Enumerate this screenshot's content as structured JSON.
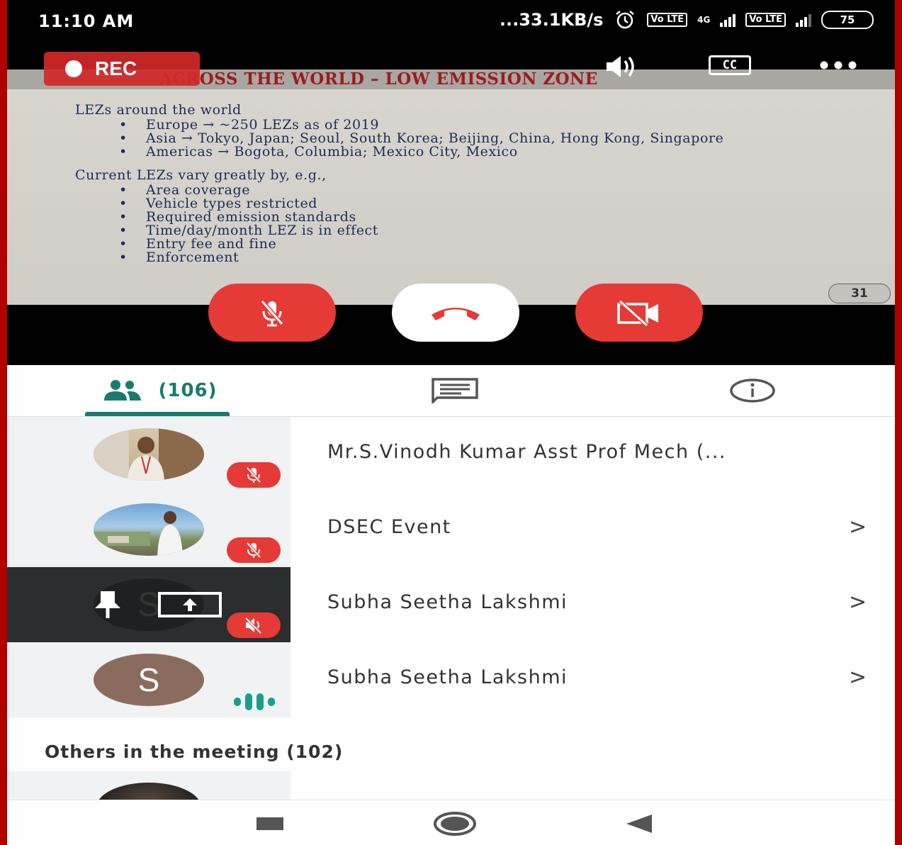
{
  "status_bar": {
    "time": "11:10 AM",
    "network_speed": "...33.1KB/s",
    "battery": "75",
    "volte_1": "Vo LTE",
    "volte_2": "Vo LTE",
    "net_type": "4G"
  },
  "video": {
    "rec_label": "REC",
    "slide": {
      "title": "ACROSS THE WORLD – LOW EMISSION ZONE",
      "section1_heading": "LEZs around the world",
      "section1_bullets": [
        "Europe → ~250 LEZs as of 2019",
        "Asia → Tokyo, Japan; Seoul, South Korea; Beijing, China, Hong Kong, Singapore",
        "Americas → Bogota, Columbia; Mexico City, Mexico"
      ],
      "section2_heading": "Current LEZs vary greatly by, e.g.,",
      "section2_bullets": [
        "Area coverage",
        "Vehicle types restricted",
        "Required emission standards",
        "Time/day/month LEZ is in effect",
        "Entry fee and fine",
        "Enforcement"
      ],
      "page_number": "31"
    },
    "cc_label": "CC"
  },
  "tabs": {
    "people_count": "(106)"
  },
  "participants": [
    {
      "name": "Mr.S.Vinodh Kumar Asst Prof Mech (...",
      "has_chevron": false
    },
    {
      "name": "DSEC Event",
      "has_chevron": true
    },
    {
      "name": "Subha Seetha Lakshmi",
      "has_chevron": true,
      "avatar_letter": "S"
    },
    {
      "name": "Subha Seetha Lakshmi",
      "has_chevron": true,
      "avatar_letter": "S"
    }
  ],
  "others_label": "Others in the meeting (102)",
  "chevron": ">",
  "colors": {
    "accent_teal": "#1a7a6e",
    "mute_red": "#e53a35",
    "slide_title_red": "#9b1c1c"
  },
  "icons": {
    "people": "people-icon",
    "chat": "chat-icon",
    "info": "info-icon",
    "mic_off": "mic-off-icon",
    "hang_up": "hang-up-icon",
    "camera_off": "camera-off-icon",
    "speaker": "speaker-icon",
    "more": "more-icon",
    "pin": "pin-icon",
    "present": "present-icon",
    "speaking": "speaking-indicator-icon"
  }
}
